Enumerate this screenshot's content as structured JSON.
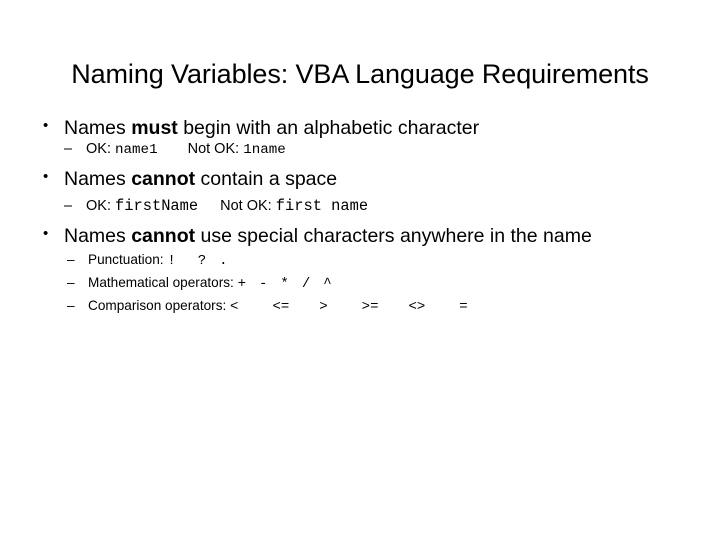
{
  "slide": {
    "title": "Naming Variables: VBA Language Requirements",
    "bullets": [
      {
        "prefix": "Names ",
        "emphasis": "must",
        "suffix": " begin with an alphabetic character",
        "sub": {
          "marker": "–",
          "ok_label": "OK: ",
          "ok_value": "name1",
          "notok_label": "Not OK: ",
          "notok_value": "1name"
        }
      },
      {
        "prefix": "Names ",
        "emphasis": "cannot",
        "suffix": " contain a space",
        "sub": {
          "marker": "–",
          "ok_label": "OK: ",
          "ok_value": "firstName",
          "notok_label": "Not OK: ",
          "notok_value": "first name"
        }
      },
      {
        "prefix": "Names ",
        "emphasis": "cannot",
        "suffix": " use special characters anywhere in the name",
        "sub_list": [
          {
            "marker": "–",
            "label": "Punctuation: ",
            "symbols": [
              "!",
              "?",
              "."
            ]
          },
          {
            "marker": "–",
            "label": "Mathematical operators: ",
            "symbols": [
              "+",
              "-",
              "*",
              "/",
              "^"
            ]
          },
          {
            "marker": "–",
            "label": "Comparison operators: ",
            "symbols": [
              "<",
              "<=",
              ">",
              ">=",
              "<>",
              "="
            ]
          }
        ]
      }
    ],
    "bullet_marker": "•",
    "colors": {
      "background": "#ffffff",
      "text": "#000000"
    }
  }
}
